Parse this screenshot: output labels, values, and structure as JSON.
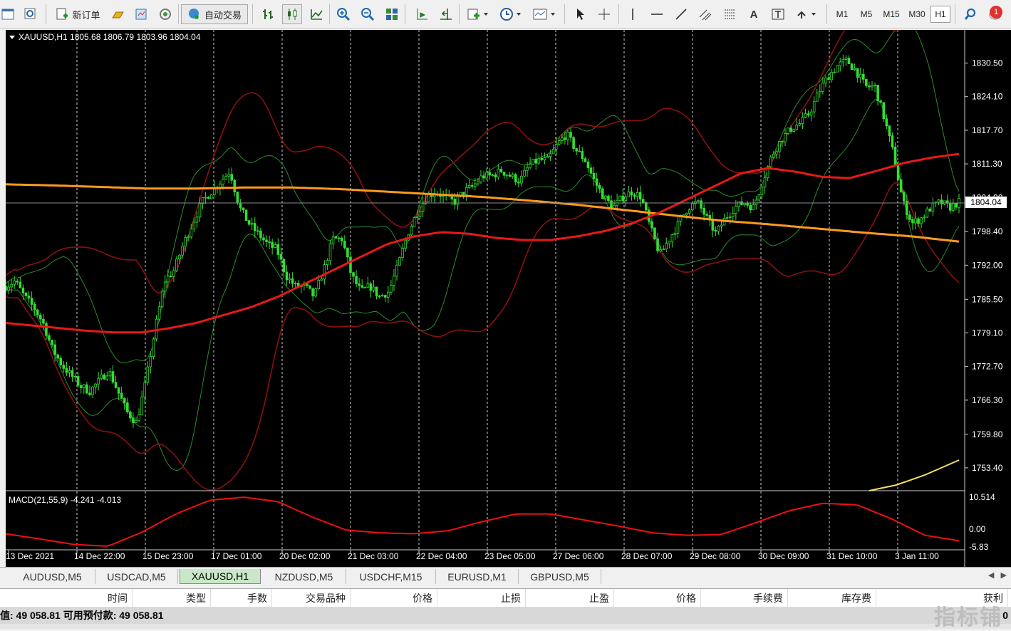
{
  "toolbar": {
    "new_order": "新订单",
    "auto_trading": "自动交易",
    "timeframes": [
      "M1",
      "M5",
      "M15",
      "M30",
      "H1"
    ],
    "active_timeframe": "H1",
    "notifications": "1"
  },
  "chart": {
    "header": "XAUUSD,H1  1805.68 1806.79 1803.96 1804.04",
    "current_price": "1804.04",
    "price_ticks": [
      "1830.50",
      "1824.10",
      "1817.70",
      "1811.30",
      "1804.90",
      "1798.40",
      "1792.00",
      "1785.50",
      "1779.10",
      "1772.70",
      "1766.30",
      "1759.80",
      "1753.40"
    ],
    "time_ticks": [
      "13 Dec 2021",
      "14 Dec 22:00",
      "15 Dec 23:00",
      "17 Dec 01:00",
      "20 Dec 02:00",
      "21 Dec 03:00",
      "22 Dec 04:00",
      "23 Dec 05:00",
      "27 Dec 06:00",
      "28 Dec 07:00",
      "29 Dec 08:00",
      "30 Dec 09:00",
      "31 Dec 10:00",
      "3 Jan 11:00"
    ],
    "macd_label": "MACD(21,55,9) -4.241 -4.013",
    "macd_ticks": [
      "10.514",
      "0.00",
      "-5.83"
    ]
  },
  "chart_data": {
    "type": "line",
    "title": "XAUUSD,H1",
    "ylim": [
      1750,
      1836
    ],
    "series": [
      {
        "values": [
          1788,
          1789,
          1786,
          1784,
          1781,
          1776,
          1773,
          1771,
          1769,
          1768,
          1770,
          1772,
          1768,
          1764,
          1762,
          1770,
          1780,
          1789,
          1791,
          1796,
          1800,
          1804,
          1806,
          1808,
          1810,
          1803,
          1800,
          1798,
          1796,
          1795,
          1790,
          1788,
          1788,
          1786,
          1791,
          1797,
          1797,
          1790,
          1787,
          1788,
          1786,
          1787,
          1792,
          1798,
          1802,
          1805,
          1806,
          1805,
          1804,
          1806,
          1807,
          1809,
          1809,
          1810,
          1809,
          1808,
          1811,
          1812,
          1812,
          1815,
          1817,
          1814,
          1812,
          1808,
          1805,
          1803,
          1805,
          1806,
          1805,
          1799,
          1794,
          1797,
          1800,
          1803,
          1804,
          1801,
          1798,
          1801,
          1803,
          1804,
          1803,
          1808,
          1813,
          1816,
          1818,
          1819,
          1821,
          1825,
          1828,
          1830,
          1831,
          1829,
          1826,
          1826,
          1820,
          1813,
          1804,
          1800,
          1801,
          1803,
          1804,
          1803,
          1804
        ]
      },
      {
        "values": [
          1781,
          1780.5,
          1780,
          1779.5,
          1779.2,
          1779.2,
          1780,
          1781,
          1782.5,
          1784,
          1786,
          1788.5,
          1791,
          1793.5,
          1796,
          1797.5,
          1798.3,
          1798,
          1797.2,
          1796.8,
          1796.8,
          1797.5,
          1798.5,
          1800,
          1802,
          1804.5,
          1807,
          1809.5,
          1810.5,
          1809.8,
          1808.8,
          1808.6,
          1810,
          1811.5,
          1812.5,
          1813.2
        ]
      },
      {
        "values": [
          1807.4,
          1807.2,
          1806.9,
          1806.6,
          1806.6,
          1806.8,
          1806.8,
          1806.5,
          1806,
          1805.5,
          1805,
          1804.3,
          1803.5,
          1802.5,
          1801.5,
          1800.5,
          1799.8,
          1799,
          1798.2,
          1797.5,
          1796.5
        ]
      },
      {
        "values": [
          -1.5,
          -3.2,
          -5.0,
          -5.6,
          -1.0,
          5.0,
          9.5,
          10.5,
          9.0,
          4.0,
          -0.3,
          -1.2,
          -1.5,
          -0.5,
          2.5,
          5.0,
          5.0,
          3.0,
          1.0,
          -1.2,
          -2.0,
          -1.8,
          2.0,
          6.0,
          8.5,
          8.0,
          3.5,
          -2.0,
          -3.8
        ]
      }
    ]
  },
  "tabs": [
    "AUDUSD,M5",
    "USDCAD,M5",
    "XAUUSD,H1",
    "NZDUSD,M5",
    "USDCHF,M15",
    "EURUSD,M1",
    "GBPUSD,M5"
  ],
  "active_tab": "XAUUSD,H1",
  "terminal": {
    "columns": [
      "时间",
      "类型",
      "手数",
      "交易品种",
      "价格",
      "止损",
      "止盈",
      "价格",
      "手续费",
      "库存费",
      "获利"
    ]
  },
  "status": {
    "text": "值: 49 058.81  可用预付款: 49 058.81",
    "right_value": "0"
  },
  "watermark": "指标铺"
}
